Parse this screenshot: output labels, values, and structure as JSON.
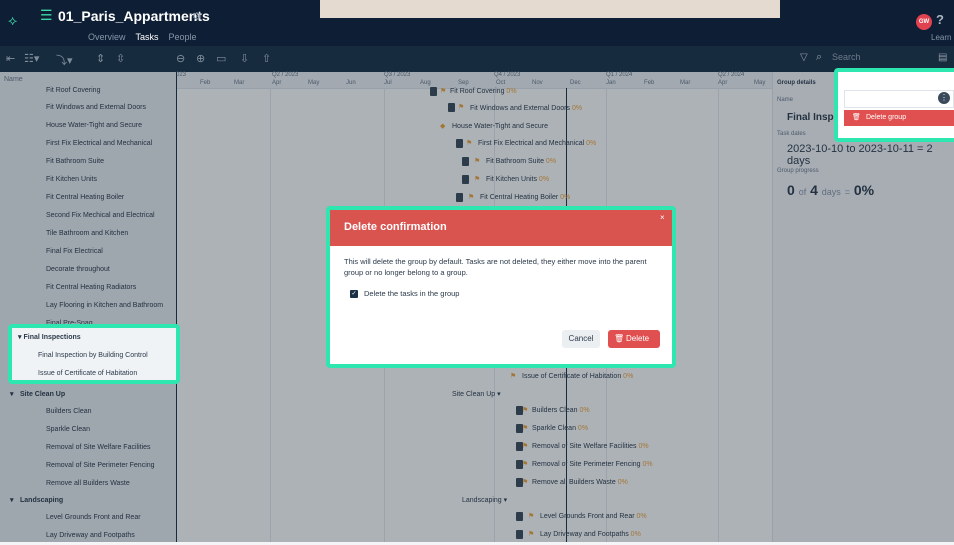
{
  "app": {
    "title": "01_Paris_Appartments",
    "nav": [
      "Overview",
      "Tasks",
      "People"
    ],
    "avatar": "GW",
    "learn": "Learn"
  },
  "toolbar": {
    "search_placeholder": "Search"
  },
  "left": {
    "header": "Name",
    "rows": [
      "Fit Roof Covering",
      "Fit Windows and External Doors",
      "House Water-Tight and Secure",
      "First Fix Electrical and Mechanical",
      "Fit Bathroom Suite",
      "Fit Kitchen Units",
      "Fit Central Heating Boiler",
      "Second Fix Mechical and Electrical",
      "Tile Bathroom and Kitchen",
      "Final Fix Electrical",
      "Decorate throughout",
      "Fit Central Heating Radiators",
      "Lay Flooring in Kitchen and Bathroom",
      "Final Pre-Snag"
    ],
    "rows2": [
      "Builders Clean",
      "Sparkle Clean",
      "Removal of Site Welfare Facilities",
      "Removal of Site Perimeter Fencing",
      "Remove all Builders Waste"
    ],
    "group_site": "Site Clean Up",
    "group_land": "Landscaping",
    "rows3": [
      "Level Grounds Front and Rear",
      "Lay Driveway and Footpaths"
    ]
  },
  "highlight": {
    "group": "Final Inspections",
    "items": [
      "Final Inspection by Building Control",
      "Issue of Certificate of Habitation"
    ]
  },
  "timeline": {
    "start_fragment": "023",
    "quarters": [
      "Q2 / 2023",
      "Q3 / 2023",
      "Q4 / 2023",
      "Q1 / 2024",
      "Q2 / 2024"
    ],
    "months": [
      "Feb",
      "Mar",
      "Apr",
      "May",
      "Jun",
      "Jul",
      "Aug",
      "Sep",
      "Oct",
      "Nov",
      "Dec",
      "Jan",
      "Feb",
      "Mar",
      "Apr",
      "May"
    ]
  },
  "gantt": {
    "labels": [
      {
        "text": "Fit Roof Covering",
        "pct": "0%"
      },
      {
        "text": "Fit Windows and External Doors",
        "pct": "0%"
      },
      {
        "text": "House Water-Tight and Secure",
        "pct": ""
      },
      {
        "text": "First Fix Electrical and Mechanical",
        "pct": "0%"
      },
      {
        "text": "Fit Bathroom Suite",
        "pct": "0%"
      },
      {
        "text": "Fit Kitchen Units",
        "pct": "0%"
      },
      {
        "text": "Fit Central Heating Boiler",
        "pct": "0%"
      },
      {
        "text": "Issue of Certificate of Habitation",
        "pct": "0%"
      },
      {
        "text": "Site Clean Up",
        "pct": ""
      },
      {
        "text": "Builders Clean",
        "pct": "0%"
      },
      {
        "text": "Sparkle Clean",
        "pct": "0%"
      },
      {
        "text": "Removal of Site Welfare Facilities",
        "pct": "0%"
      },
      {
        "text": "Removal of Site Perimeter Fencing",
        "pct": "0%"
      },
      {
        "text": "Remove all Builders Waste",
        "pct": "0%"
      },
      {
        "text": "Landscaping",
        "pct": ""
      },
      {
        "text": "Level Grounds Front and Rear",
        "pct": "0%"
      },
      {
        "text": "Lay Driveway and Footpaths",
        "pct": "0%"
      }
    ]
  },
  "details": {
    "heading": "Group details",
    "name_label": "Name",
    "name_value": "Final Insp",
    "dates_label": "Task dates",
    "dates_value": "2023-10-10 to 2023-10-11 = 2 days",
    "progress_label": "Group progress",
    "progress_prefix": "0",
    "progress_of": "of",
    "progress_total": "4",
    "progress_days": "days",
    "progress_eq": "=",
    "progress_pct": "0%",
    "delete_group": "Delete group"
  },
  "modal": {
    "title": "Delete confirmation",
    "body": "This will delete the group by default. Tasks are not deleted, they either move into the parent group or no longer belong to a group.",
    "checkbox_label": "Delete the tasks in the group",
    "checkbox_checked": true,
    "cancel": "Cancel",
    "delete": "Delete"
  }
}
